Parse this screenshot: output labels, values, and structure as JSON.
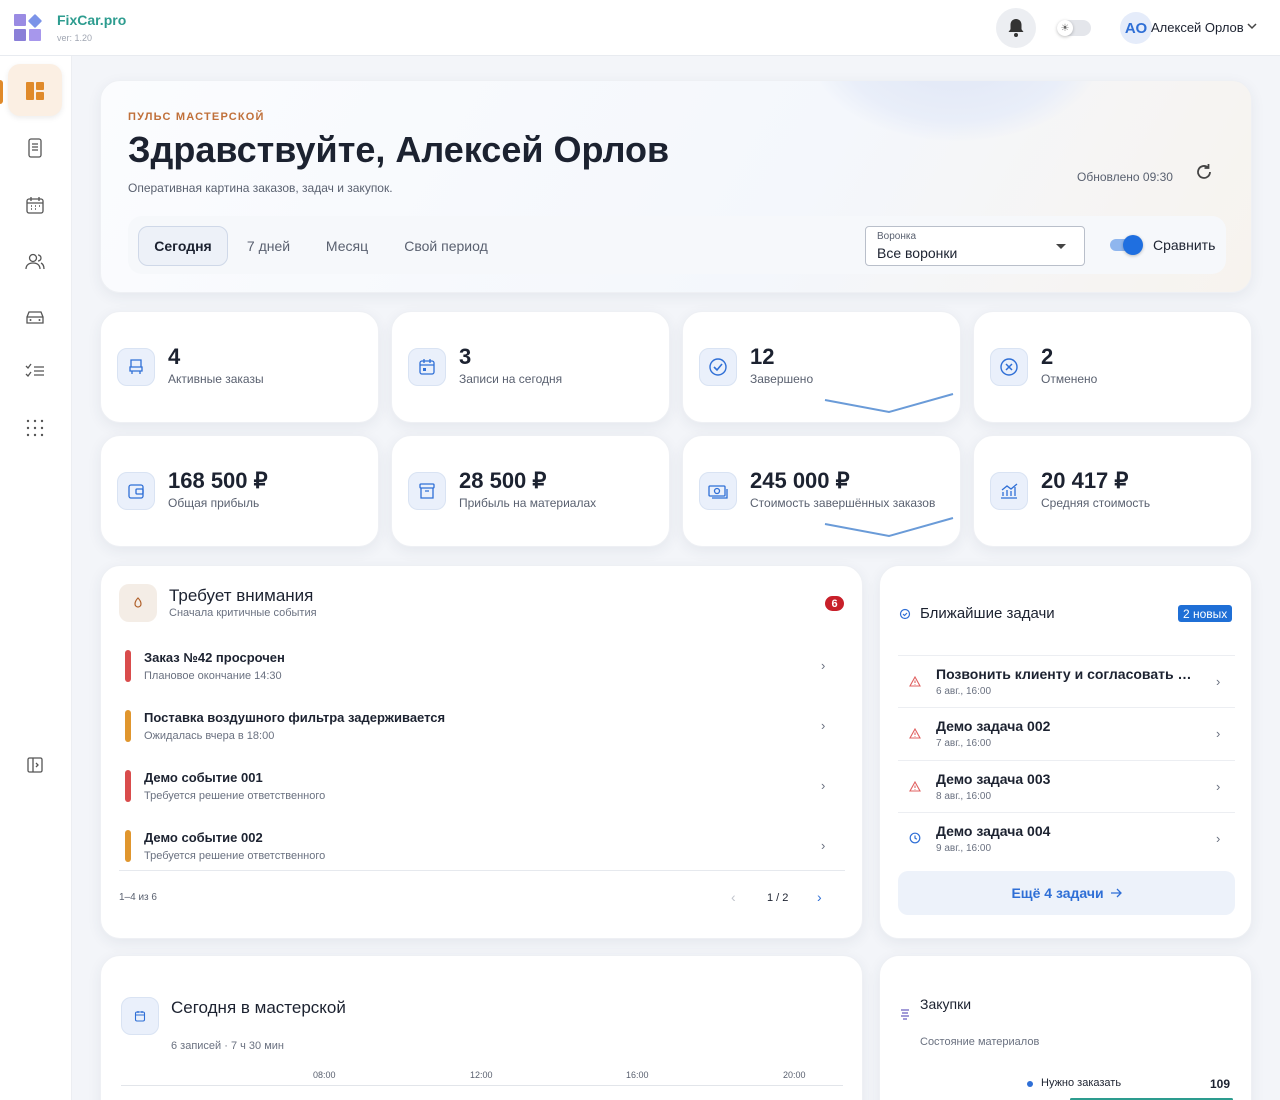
{
  "app": {
    "name": "FixCar.pro",
    "version": "ver: 1.20"
  },
  "user": {
    "initials": "АО",
    "name": "Алексей Орлов"
  },
  "hero": {
    "kicker": "ПУЛЬС МАСТЕРСКОЙ",
    "title": "Здравствуйте, Алексей Орлов",
    "subtitle": "Оперативная картина заказов, задач и закупок.",
    "updated": "Обновлено 09:30",
    "tabs": [
      "Сегодня",
      "7 дней",
      "Месяц",
      "Свой период"
    ],
    "active_tab": "Сегодня",
    "funnel": {
      "label": "Воронка",
      "value": "Все воронки"
    },
    "compare": {
      "label": "Сравнить",
      "enabled": true
    }
  },
  "stats": [
    {
      "value": "4",
      "label": "Активные заказы",
      "icon": "car-seat-icon"
    },
    {
      "value": "3",
      "label": "Записи на сегодня",
      "icon": "calendar-icon"
    },
    {
      "value": "12",
      "label": "Завершено",
      "icon": "check-circle-icon"
    },
    {
      "value": "2",
      "label": "Отменено",
      "icon": "x-circle-icon"
    },
    {
      "value": "168 500 ₽",
      "label": "Общая прибыль",
      "icon": "wallet-icon"
    },
    {
      "value": "28 500 ₽",
      "label": "Прибыль на материалах",
      "icon": "archive-icon"
    },
    {
      "value": "245 000 ₽",
      "label": "Стоимость завершённых заказов",
      "icon": "cash-icon"
    },
    {
      "value": "20 417 ₽",
      "label": "Средняя стоимость",
      "icon": "analytics-icon"
    }
  ],
  "attention": {
    "title": "Требует внимания",
    "subtitle": "Сначала критичные события",
    "count": "6",
    "items": [
      {
        "title": "Заказ №42 просрочен",
        "sub": "Плановое окончание 14:30",
        "severity": "critical",
        "color": "#d94c4c"
      },
      {
        "title": "Поставка воздушного фильтра задерживается",
        "sub": "Ожидалась вчера в 18:00",
        "severity": "warning",
        "color": "#e0962e"
      },
      {
        "title": "Демо событие 001",
        "sub": "Требуется решение ответственного",
        "severity": "critical",
        "color": "#d94c4c"
      },
      {
        "title": "Демо событие 002",
        "sub": "Требуется решение ответственного",
        "severity": "warning",
        "color": "#e0962e"
      }
    ],
    "range": "1–4 из 6",
    "page": "1 / 2"
  },
  "tasks": {
    "title": "Ближайшие задачи",
    "badge": "2 новых",
    "items": [
      {
        "title": "Позвонить клиенту и согласовать д...",
        "date": "6 авг., 16:00",
        "icon": "warning-icon"
      },
      {
        "title": "Демо задача 002",
        "date": "7 авг., 16:00",
        "icon": "warning-icon"
      },
      {
        "title": "Демо задача 003",
        "date": "8 авг., 16:00",
        "icon": "warning-icon"
      },
      {
        "title": "Демо задача 004",
        "date": "9 авг., 16:00",
        "icon": "clock-icon"
      }
    ],
    "more": "Ещё 4 задачи"
  },
  "today": {
    "title": "Сегодня в мастерской",
    "subtitle": "6 записей · 7 ч 30 мин",
    "hours": [
      "08:00",
      "12:00",
      "16:00",
      "20:00"
    ]
  },
  "purchases": {
    "title": "Закупки",
    "subtitle": "Состояние материалов",
    "item_label": "Нужно заказать",
    "item_value": "109"
  },
  "colors": {
    "accent": "#2f6fd6",
    "brand": "#2d9c8f",
    "critical": "#d94c4c",
    "warning": "#e0962e"
  }
}
